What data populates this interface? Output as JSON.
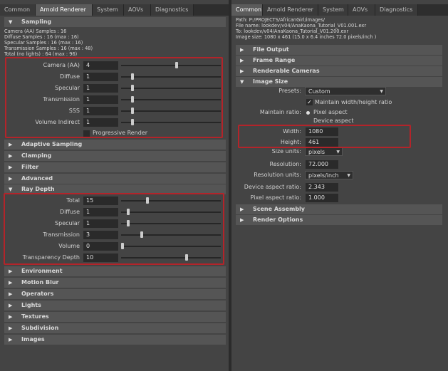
{
  "left": {
    "tabs": [
      "Common",
      "Arnold Renderer",
      "System",
      "AOVs",
      "Diagnostics"
    ],
    "active_tab": "Arnold Renderer",
    "sampling": {
      "title": "Sampling",
      "info": [
        "Camera (AA) Samples : 16",
        "Diffuse Samples : 16 (max : 16)",
        "Specular Samples : 16 (max : 16)",
        "Transmission Samples : 16 (max : 48)",
        "Total (no lights) : 64 (max : 96)"
      ],
      "fields": [
        {
          "label": "Camera (AA)",
          "value": "4",
          "level": 0.56
        },
        {
          "label": "Diffuse",
          "value": "1",
          "level": 0.1
        },
        {
          "label": "Specular",
          "value": "1",
          "level": 0.1
        },
        {
          "label": "Transmission",
          "value": "1",
          "level": 0.1
        },
        {
          "label": "SSS",
          "value": "1",
          "level": 0.1
        },
        {
          "label": "Volume Indirect",
          "value": "1",
          "level": 0.1
        }
      ],
      "progressive_label": "Progressive Render"
    },
    "collapsed_mid": [
      "Adaptive Sampling",
      "Clamping",
      "Filter",
      "Advanced"
    ],
    "ray_depth": {
      "title": "Ray Depth",
      "fields": [
        {
          "label": "Total",
          "value": "15",
          "level": 0.26
        },
        {
          "label": "Diffuse",
          "value": "1",
          "level": 0.06
        },
        {
          "label": "Specular",
          "value": "1",
          "level": 0.06
        },
        {
          "label": "Transmission",
          "value": "3",
          "level": 0.2
        },
        {
          "label": "Volume",
          "value": "0",
          "level": 0.0
        },
        {
          "label": "Transparency Depth",
          "value": "10",
          "level": 0.66
        }
      ]
    },
    "collapsed_bottom": [
      "Environment",
      "Motion Blur",
      "Operators",
      "Lights",
      "Textures",
      "Subdivision",
      "Images"
    ]
  },
  "right": {
    "tabs": [
      "Common",
      "Arnold Renderer",
      "System",
      "AOVs",
      "Diagnostics"
    ],
    "active_tab": "Common",
    "info": [
      "Path: P:/PROJECTS/AfricanGirl/images/",
      "File name:   lookdev/v04/AnaKaona_Tutorial_V01.001.exr",
      "To:            lookdev/v04/AnaKaona_Tutorial_V01.200.exr",
      "Image size: 1080 x 461 (15.0 x 6.4 inches 72.0 pixels/inch )"
    ],
    "sections_top": [
      "File Output",
      "Frame Range",
      "Renderable Cameras"
    ],
    "image_size": {
      "title": "Image Size",
      "presets_label": "Presets:",
      "presets_value": "Custom",
      "maintain_wh_label": "Maintain width/height ratio",
      "maintain_ratio_label": "Maintain ratio:",
      "pixel_aspect_label": "Pixel aspect",
      "device_aspect_label": "Device aspect",
      "width_label": "Width:",
      "width_value": "1080",
      "height_label": "Height:",
      "height_value": "461",
      "size_units_label": "Size units:",
      "size_units_value": "pixels",
      "resolution_label": "Resolution:",
      "resolution_value": "72.000",
      "resolution_units_label": "Resolution units:",
      "resolution_units_value": "pixels/inch",
      "device_aspect_ratio_label": "Device aspect ratio:",
      "device_aspect_ratio_value": "2.343",
      "pixel_aspect_ratio_label": "Pixel aspect ratio:",
      "pixel_aspect_ratio_value": "1.000"
    },
    "sections_bottom": [
      "Scene Assembly",
      "Render Options"
    ]
  },
  "colors": {
    "highlight": "#b3242a",
    "active_tab": "#5b5b5b",
    "panel": "#444444"
  },
  "icons": {
    "collapsed": "triangle-right-icon",
    "expanded": "triangle-down-icon",
    "dropdown": "chevron-down-icon"
  }
}
